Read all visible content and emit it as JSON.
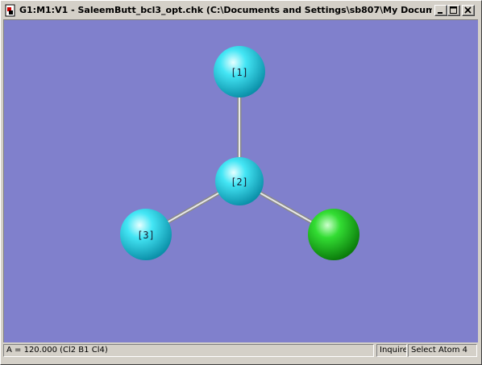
{
  "window": {
    "title": "G1:M1:V1 - SaleemButt_bcl3_opt.chk (C:\\Documents and Settings\\sb807\\My Documents..."
  },
  "title_buttons": {
    "minimize_icon": "minimize-icon",
    "maximize_icon": "maximize-icon",
    "close_icon": "close-icon"
  },
  "molecule": {
    "atoms": [
      {
        "label": "[1]",
        "color": "#33ddee"
      },
      {
        "label": "[2]",
        "color": "#33ddee"
      },
      {
        "label": "[3]",
        "color": "#33ddee"
      },
      {
        "label": "",
        "color": "#22cc22"
      }
    ],
    "bond_color": "#cccccc",
    "background_color": "#8080cc"
  },
  "statusbar": {
    "measurement": "A = 120.000 (Cl2 B1 Cl4)",
    "mode": "Inquire",
    "prompt": "Select Atom 4"
  }
}
